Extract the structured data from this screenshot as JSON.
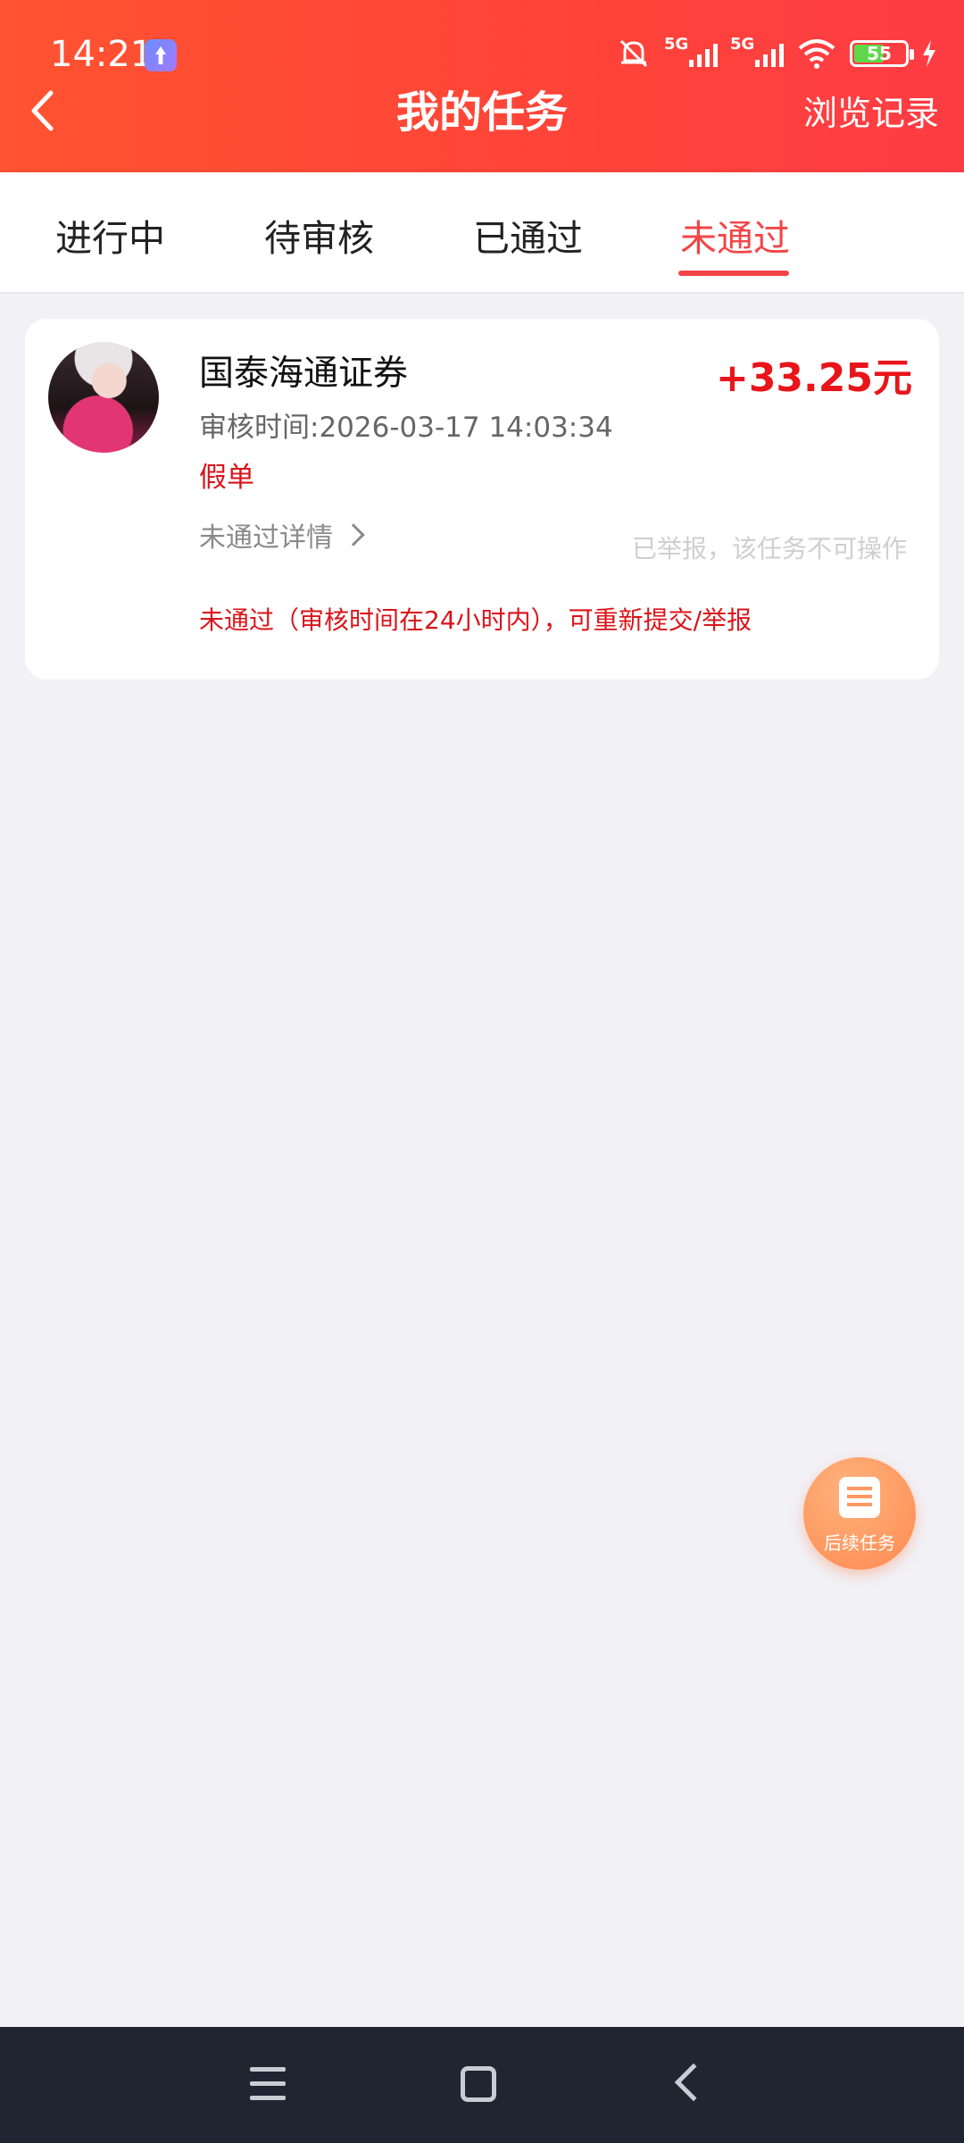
{
  "status_bar": {
    "time": "14:21",
    "network_1": "5G",
    "network_2": "5G",
    "battery": "55"
  },
  "header": {
    "title": "我的任务",
    "history_label": "浏览记录"
  },
  "tabs": [
    {
      "label": "进行中"
    },
    {
      "label": "待审核"
    },
    {
      "label": "已通过"
    },
    {
      "label": "未通过",
      "active": true
    }
  ],
  "task": {
    "title": "国泰海通证券",
    "reward": "+33.25元",
    "review_time": "审核时间:2026-03-17 14:03:34",
    "reason": "假单",
    "detail_label": "未通过详情",
    "reported_note": "已举报，该任务不可操作",
    "fail_note": "未通过（审核时间在24小时内），可重新提交/举报"
  },
  "float_button": {
    "label": "后续任务"
  },
  "colors": {
    "header": "#ff4338",
    "accent": "#f24547",
    "reward": "#e8151b"
  }
}
